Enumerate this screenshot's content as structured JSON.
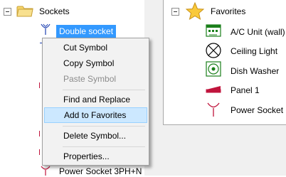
{
  "left_tree": {
    "folder_label": "Sockets",
    "selected_label": "Double socket",
    "bottom_label": "Power Socket 3PH+N"
  },
  "context_menu": {
    "items": [
      {
        "label": "Cut Symbol",
        "enabled": true
      },
      {
        "label": "Copy Symbol",
        "enabled": true
      },
      {
        "label": "Paste Symbol",
        "enabled": false
      },
      {
        "label": "Find and Replace",
        "enabled": true
      },
      {
        "label": "Add to Favorites",
        "enabled": true,
        "highlighted": true
      },
      {
        "label": "Delete Symbol...",
        "enabled": true
      },
      {
        "label": "Properties...",
        "enabled": true
      }
    ]
  },
  "favorites": {
    "title": "Favorites",
    "items": [
      {
        "label": "A/C Unit (wall)",
        "icon": "ac-unit-icon"
      },
      {
        "label": "Ceiling Light",
        "icon": "ceiling-light-icon"
      },
      {
        "label": "Dish Washer",
        "icon": "dish-washer-icon"
      },
      {
        "label": "Panel 1",
        "icon": "panel-icon"
      },
      {
        "label": "Power Socket",
        "icon": "power-socket-icon"
      }
    ]
  },
  "colors": {
    "selection": "#3399ff",
    "menu_highlight": "#cce8ff",
    "symbol_green": "#1a7f1a",
    "symbol_red": "#c0143c",
    "symbol_blue": "#1c3fb0"
  }
}
